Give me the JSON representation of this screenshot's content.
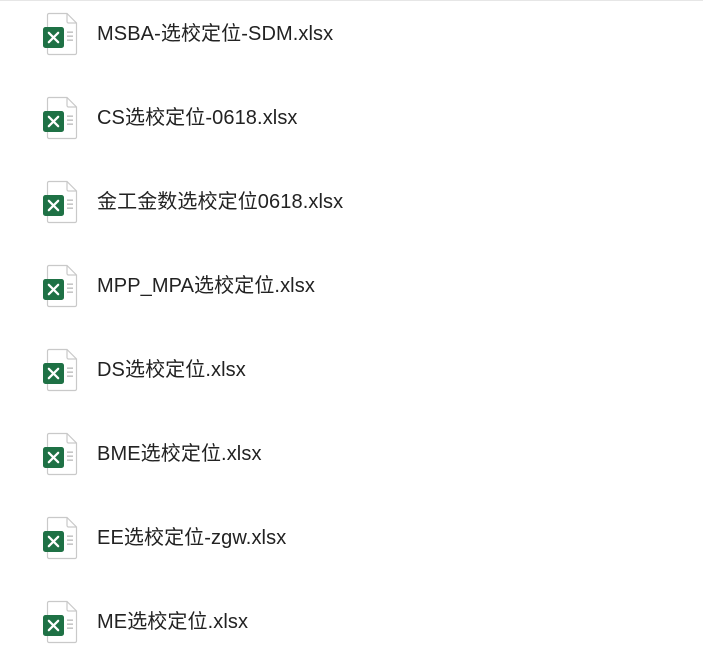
{
  "files": [
    {
      "name": "MSBA-选校定位-SDM.xlsx",
      "icon": "excel-file-icon"
    },
    {
      "name": "CS选校定位-0618.xlsx",
      "icon": "excel-file-icon"
    },
    {
      "name": "金工金数选校定位0618.xlsx",
      "icon": "excel-file-icon"
    },
    {
      "name": "MPP_MPA选校定位.xlsx",
      "icon": "excel-file-icon"
    },
    {
      "name": "DS选校定位.xlsx",
      "icon": "excel-file-icon"
    },
    {
      "name": "BME选校定位.xlsx",
      "icon": "excel-file-icon"
    },
    {
      "name": "EE选校定位-zgw.xlsx",
      "icon": "excel-file-icon"
    },
    {
      "name": "ME选校定位.xlsx",
      "icon": "excel-file-icon"
    }
  ],
  "colors": {
    "excel_green": "#1e7145",
    "page_outline": "#c9c9c9",
    "text": "#222222"
  }
}
